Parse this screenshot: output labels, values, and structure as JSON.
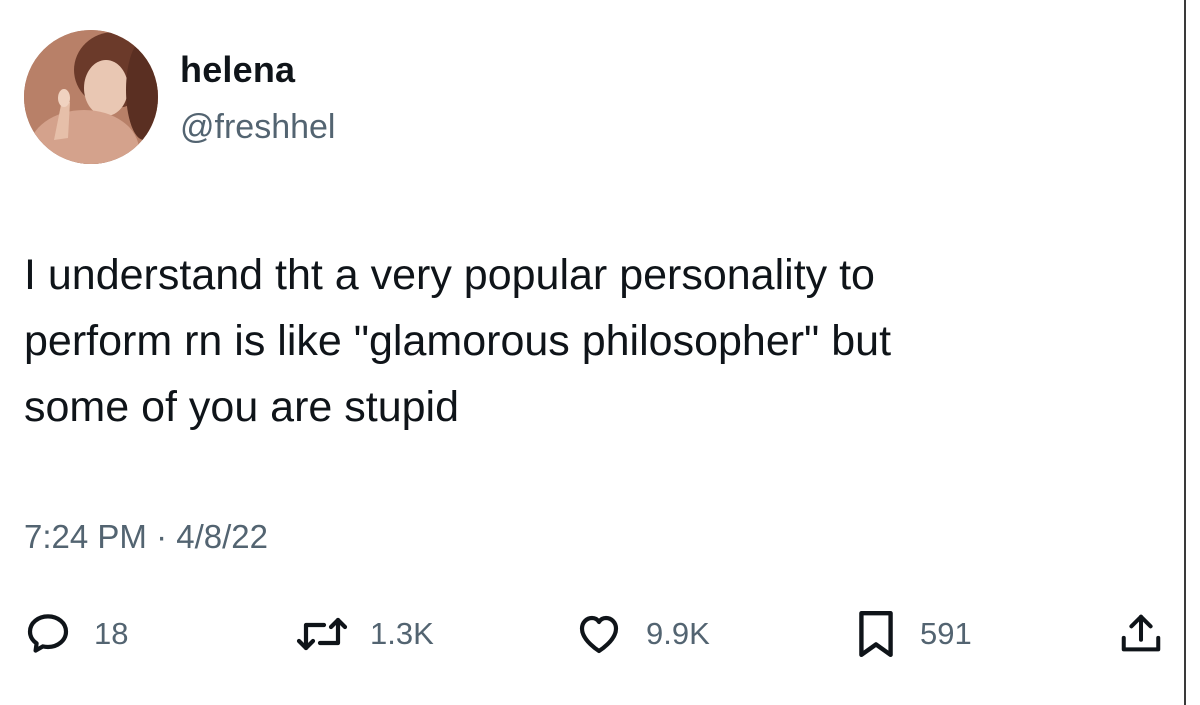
{
  "user": {
    "display_name": "helena",
    "handle": "@freshhel",
    "avatar_icon": "profile-photo"
  },
  "tweet": {
    "lines": [
      "I understand tht a very popular personality to",
      "perform rn is like \"glamorous philosopher\" but",
      "some of you are stupid"
    ],
    "timestamp": "7:24 PM · 4/8/22"
  },
  "actions": {
    "reply": {
      "icon": "reply-icon",
      "count": "18"
    },
    "retweet": {
      "icon": "retweet-icon",
      "count": "1.3K"
    },
    "like": {
      "icon": "heart-icon",
      "count": "9.9K"
    },
    "bookmark": {
      "icon": "bookmark-icon",
      "count": "591"
    },
    "share": {
      "icon": "share-icon"
    }
  },
  "colors": {
    "text_primary": "#0f1419",
    "text_secondary": "#536471",
    "background": "#ffffff"
  }
}
